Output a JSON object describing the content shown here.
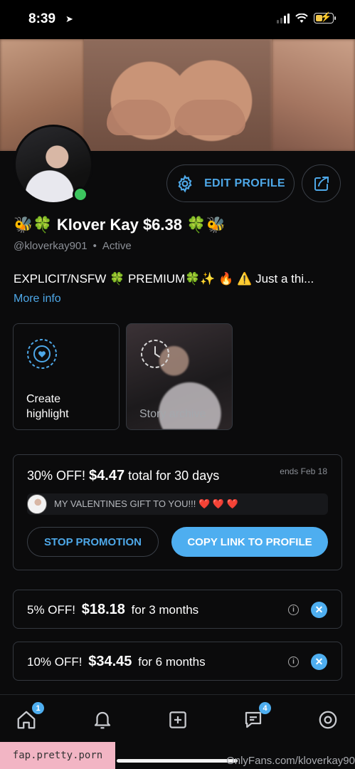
{
  "status_bar": {
    "time": "8:39",
    "location_icon": "location-arrow-icon"
  },
  "profile": {
    "display_name": "🐝🍀 Klover Kay $6.38 🍀🐝",
    "handle": "@kloverkay901",
    "status": "Active",
    "bio": "EXPLICIT/NSFW 🍀 PREMIUM🍀✨ 🔥 ⚠️ Just a thi...",
    "more_info": "More info",
    "online_color": "#3cc55e"
  },
  "actions": {
    "edit_profile": "EDIT PROFILE"
  },
  "highlights": {
    "create_label": "Create highlight",
    "archive_label": "Story archive"
  },
  "promotion": {
    "discount": "30% OFF!",
    "price": "$4.47",
    "terms": "total for 30 days",
    "ends": "ends Feb 18",
    "message": "MY VALENTINES GIFT TO YOU!!! ❤️ ❤️ ❤️",
    "stop_label": "STOP PROMOTION",
    "copy_label": "COPY LINK TO PROFILE"
  },
  "bundles": [
    {
      "discount": "5% OFF!",
      "price": "$18.18",
      "terms": "for 3 months"
    },
    {
      "discount": "10% OFF!",
      "price": "$34.45",
      "terms": "for 6 months"
    }
  ],
  "nav": {
    "home_badge": "1",
    "messages_badge": "4"
  },
  "overlay": {
    "watermark": "fap.pretty.porn",
    "site": "OnlyFans.com/kloverkay90"
  },
  "colors": {
    "accent": "#4eaef0",
    "link": "#4ea8e8",
    "background": "#0b0b0c"
  }
}
